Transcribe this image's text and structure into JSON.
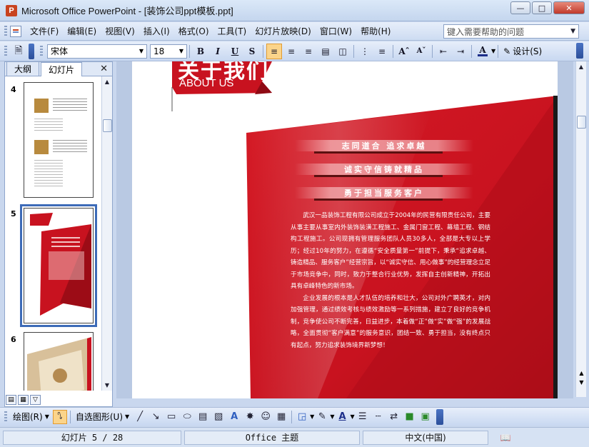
{
  "window": {
    "title": "Microsoft Office PowerPoint - [装饰公司ppt模板.ppt]",
    "app_icon": "powerpoint-icon"
  },
  "menu": {
    "items": [
      "文件(F)",
      "编辑(E)",
      "视图(V)",
      "插入(I)",
      "格式(O)",
      "工具(T)",
      "幻灯片放映(D)",
      "窗口(W)",
      "帮助(H)"
    ],
    "help_placeholder": "键入需要帮助的问题"
  },
  "format_toolbar": {
    "font_name": "宋体",
    "font_size": "18",
    "bold": "B",
    "italic": "I",
    "underline": "U",
    "shadow": "S",
    "font_color_letter": "A",
    "design_label": "设计(S)"
  },
  "left_panel": {
    "tabs": [
      "大纲",
      "幻灯片"
    ],
    "active_tab": "幻灯片",
    "slide_numbers": [
      "4",
      "5",
      "6"
    ],
    "selected_slide": "5"
  },
  "slide": {
    "heading_cn": "关于我们",
    "heading_en": "ABOUT US",
    "slogans": [
      "志同道合  追求卓越",
      "诚实守信铸就精品",
      "勇于担当服务客户"
    ],
    "paragraph_1": "武汉一品装饰工程有限公司成立于2004年的民营有限责任公司，主要从事主要从事室内外装饰装潢工程施工、金属门窗工程、幕墙工程、钢结构工程施工。公司现拥有管理服务团队人员30多人，全部是大专以上学历；经过10年的努力，在遵循“安全质量第一”前提下，秉承“追求卓越、铸造精品、服务客户”经营宗旨，以“诚实守信、用心做事”的经营理念立足于市场竞争中，同时，致力于整合行业优势，发挥自主创新精神，开拓出具有卓峰特色的新市场。",
    "paragraph_2": "企业发展的根本是人才队伍的培养和壮大，公司对外广聘英才，对内加强管理，通过绩效考核与绩效激励等一系列措施，建立了良好的竞争机制，竞争使公司不断完善，日益进步，本着做“正”做“实”做“强”的发展战略，全面贯彻“客户满意”的服务意识，团结一致、勇于担当，没有终点只有起点，努力追求装饰境界新梦想！"
  },
  "drawing_toolbar": {
    "draw_label": "绘图(R)",
    "autoshapes_label": "自选图形(U)"
  },
  "status_bar": {
    "slide_position": "幻灯片 5 / 28",
    "theme": "Office 主题",
    "language": "中文(中国)"
  },
  "colors": {
    "brand_red": "#c8121f",
    "accent_blue": "#3d6bb8"
  }
}
